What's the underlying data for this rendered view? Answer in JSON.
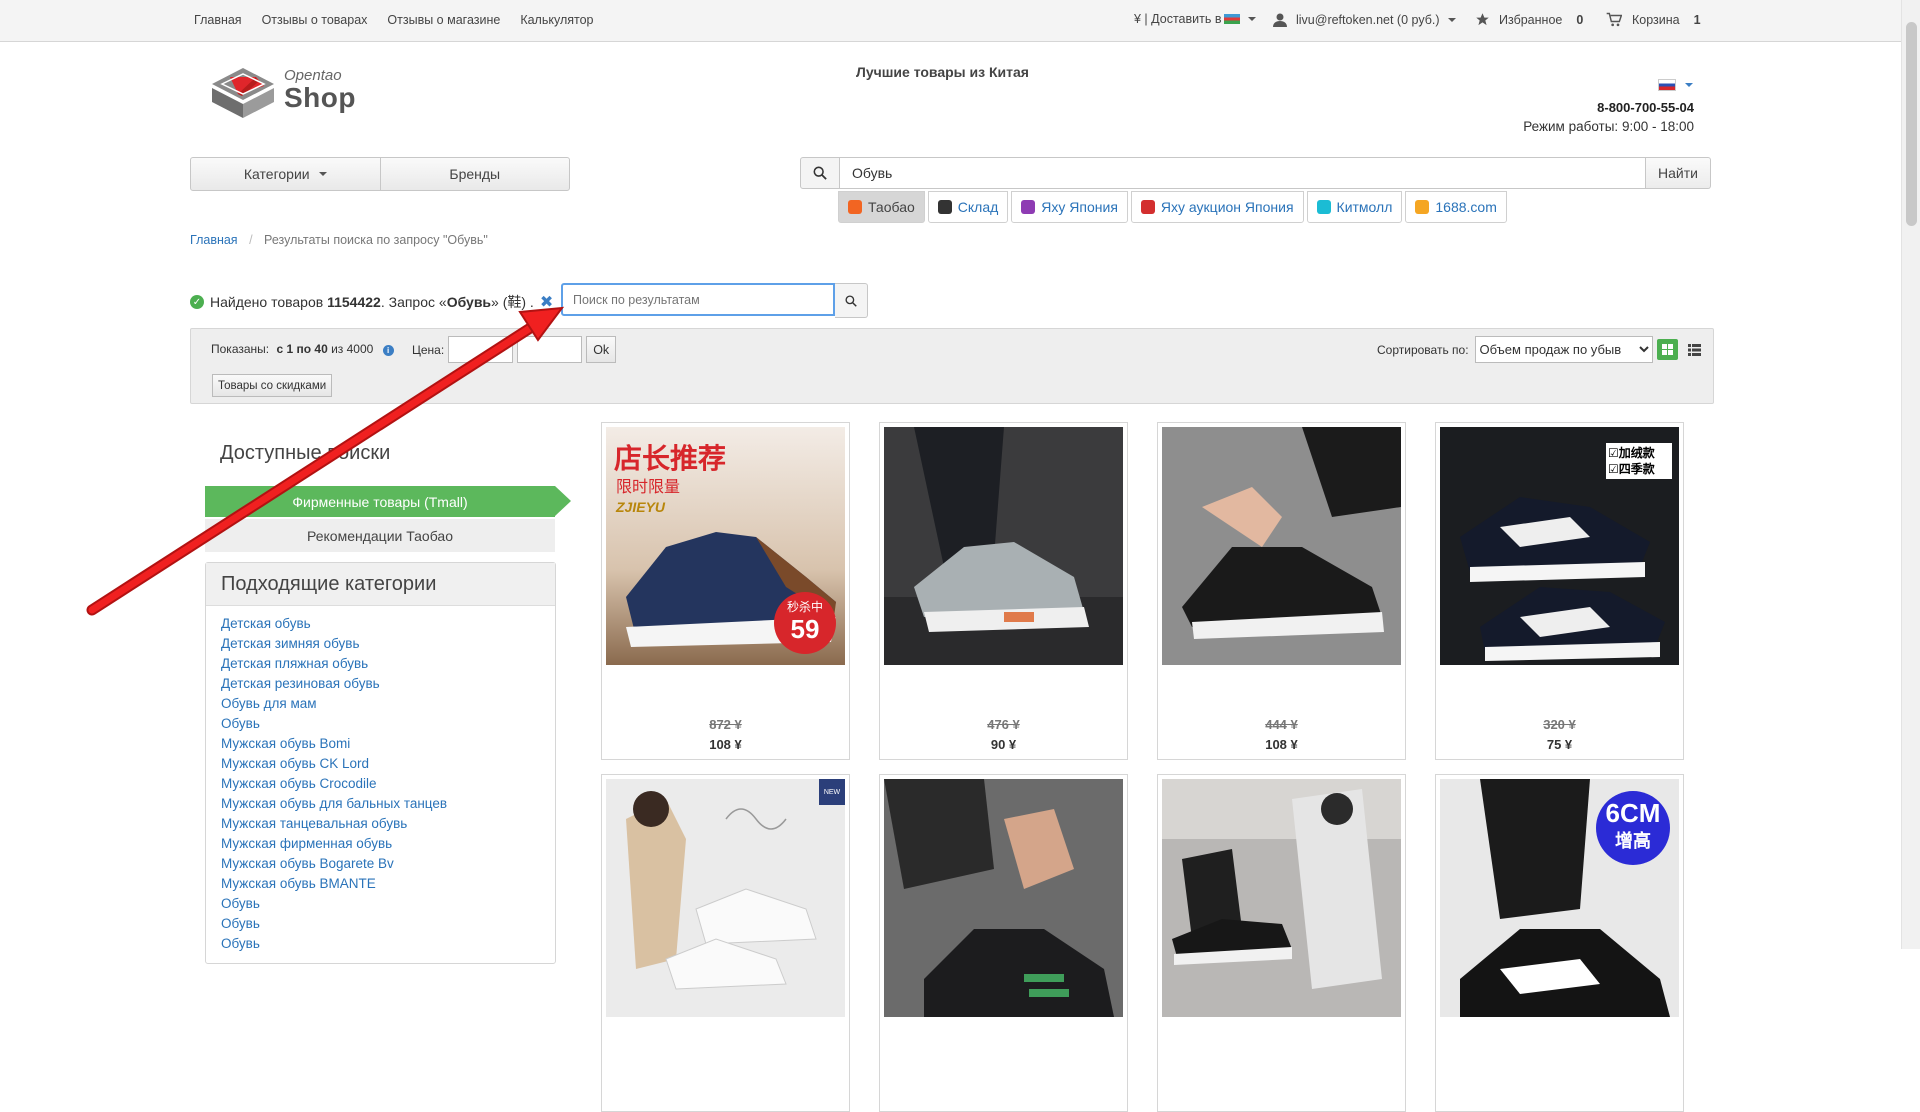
{
  "topbar": {
    "nav": [
      "Главная",
      "Отзывы о товарах",
      "Отзывы о магазине",
      "Калькулятор"
    ],
    "deliver": "¥ | Доставить в",
    "user": "livu@reftoken.net (0 руб.)",
    "favorites_label": "Избранное",
    "favorites_count": "0",
    "cart_label": "Корзина",
    "cart_count": "1"
  },
  "header": {
    "logo_word1": "Opentao",
    "logo_word2": "Shop",
    "tagline": "Лучшие товары из Китая",
    "phone": "8-800-700-55-04",
    "hours": "Режим работы: 9:00 - 18:00"
  },
  "menu": {
    "categories": "Категории",
    "brands": "Бренды"
  },
  "search": {
    "value": "Обувь",
    "button": "Найти"
  },
  "providers": [
    {
      "label": "Таобао",
      "color": "#f26522"
    },
    {
      "label": "Склад",
      "color": "#333333"
    },
    {
      "label": "Яху Япония",
      "color": "#8e3bb3"
    },
    {
      "label": "Яху аукцион Япония",
      "color": "#d32f2f"
    },
    {
      "label": "Китмолл",
      "color": "#1bbcd4"
    },
    {
      "label": "1688.com",
      "color": "#f5a623"
    }
  ],
  "breadcrumb": {
    "home": "Главная",
    "current": "Результаты поиска по запросу \"Обувь\""
  },
  "results": {
    "found_prefix": "Найдено товаров",
    "count": "1154422",
    "query_prefix": ". Запрос «",
    "query": "Обувь",
    "query_suffix": "» (鞋) .",
    "sub_placeholder": "Поиск по результатам"
  },
  "filter": {
    "shown_label": "Показаны:",
    "shown_range": "с 1 по 40",
    "shown_of": "из 4000",
    "price_label": "Цена:",
    "ok": "Ok",
    "discount": "Товары со скидками",
    "sort_label": "Сортировать по:",
    "sort_value": "Объем продаж по убыв"
  },
  "sidebar": {
    "available_title": "Доступные поиски",
    "tmall": "Фирменные товары (Tmall)",
    "reco": "Рекомендации Таобао",
    "categories_title": "Подходящие категории",
    "categories": [
      "Детская обувь",
      "Детская зимняя обувь",
      "Детская пляжная обувь",
      "Детская резиновая обувь",
      "Обувь для мам",
      "Обувь",
      "Мужская обувь Bomi",
      "Мужская обувь CK Lord",
      "Мужская обувь Crocodile",
      "Мужская обувь для бальных танцев",
      "Мужская танцевальная обувь",
      "Мужская фирменная обувь",
      "Мужская обувь Bogarete Bv",
      "Мужская обувь BMANTE",
      "Обувь",
      "Обувь",
      "Обувь"
    ]
  },
  "products": [
    {
      "old": "872 ¥",
      "price": "108 ¥",
      "badge1": "店长推荐",
      "badge2": "限时限量",
      "brand": "ZJIEYU",
      "promo1": "秒杀中",
      "promo2": "59"
    },
    {
      "old": "476 ¥",
      "price": "90 ¥"
    },
    {
      "old": "444 ¥",
      "price": "108 ¥"
    },
    {
      "old": "320 ¥",
      "price": "75 ¥",
      "tag1": "☑加绒款",
      "tag2": "☑四季款"
    },
    {
      "old": "",
      "price": "",
      "new": "NEW"
    },
    {
      "old": "",
      "price": ""
    },
    {
      "old": "",
      "price": ""
    },
    {
      "old": "",
      "price": "",
      "cm": "6CM",
      "cm2": "增高"
    }
  ]
}
